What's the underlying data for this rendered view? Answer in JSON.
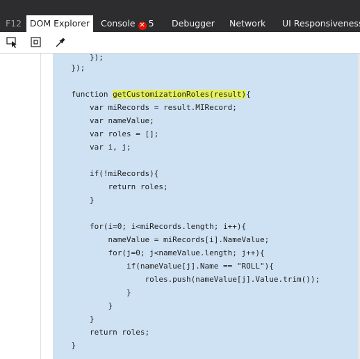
{
  "tabs": {
    "f12": "F12",
    "dom_explorer": "DOM Explorer",
    "console": "Console",
    "console_error_count": "5",
    "debugger": "Debugger",
    "network": "Network",
    "ui_responsiveness": "UI Responsiveness"
  },
  "toolbar": {
    "select_element_icon": "select-element-icon",
    "box_model_icon": "box-model-icon",
    "color_picker_icon": "eyedropper-icon"
  },
  "code": {
    "line1": "        });",
    "line2": "    });",
    "line3": "",
    "line4_pre": "    function ",
    "line4_hl": "getCustomizationRoles(result)",
    "line4_post": "{",
    "line5": "        var miRecords = result.MIRecord;",
    "line6": "        var nameValue;",
    "line7": "        var roles = [];",
    "line8": "        var i, j;",
    "line9": "",
    "line10": "        if(!miRecords){",
    "line11": "            return roles;",
    "line12": "        }",
    "line13": "",
    "line14": "        for(i=0; i<miRecords.length; i++){",
    "line15": "            nameValue = miRecords[i].NameValue;",
    "line16": "            for(j=0; j<nameValue.length; j++){",
    "line17": "                if(nameValue[j].Name == \"ROLL\"){",
    "line18": "                    roles.push(nameValue[j].Value.trim());",
    "line19": "                }",
    "line20": "            }",
    "line21": "        }",
    "line22": "        return roles;",
    "line23": "    }"
  },
  "colors": {
    "tabbar": "#2d2d30",
    "code_background": "#cfe2f3",
    "highlight": "#e4f05c",
    "error_badge": "#e51400"
  }
}
